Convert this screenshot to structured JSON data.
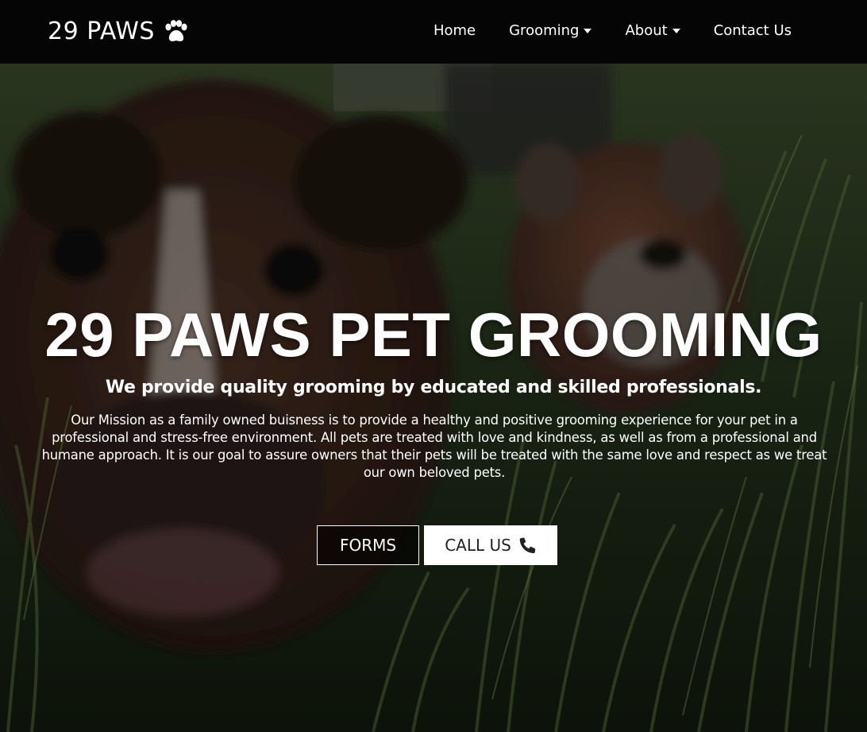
{
  "brand": {
    "name": "29 PAWS",
    "icon": "paw-icon"
  },
  "nav": {
    "items": [
      {
        "label": "Home",
        "dropdown": false
      },
      {
        "label": "Grooming",
        "dropdown": true
      },
      {
        "label": "About",
        "dropdown": true
      },
      {
        "label": "Contact Us",
        "dropdown": false
      }
    ]
  },
  "hero": {
    "title": "29 PAWS PET GROOMING",
    "subtitle": "We provide quality grooming by educated and skilled professionals.",
    "mission": "Our Mission as a family owned buisness is to provide a healthy and positive grooming experience for your pet in a professional and stress-free environment. All pets are treated with love and kindness, as well as from a professional and humane approach. It is our goal to assure owners that their pets will be treated with the same love and respect as we treat our own beloved pets.",
    "buttons": {
      "forms_label": "FORMS",
      "call_label": "CALL US",
      "call_icon": "phone-icon"
    }
  },
  "colors": {
    "navbar_bg": "#050505",
    "text": "#ffffff",
    "call_button_bg": "#ffffff",
    "call_button_text": "#222222"
  }
}
